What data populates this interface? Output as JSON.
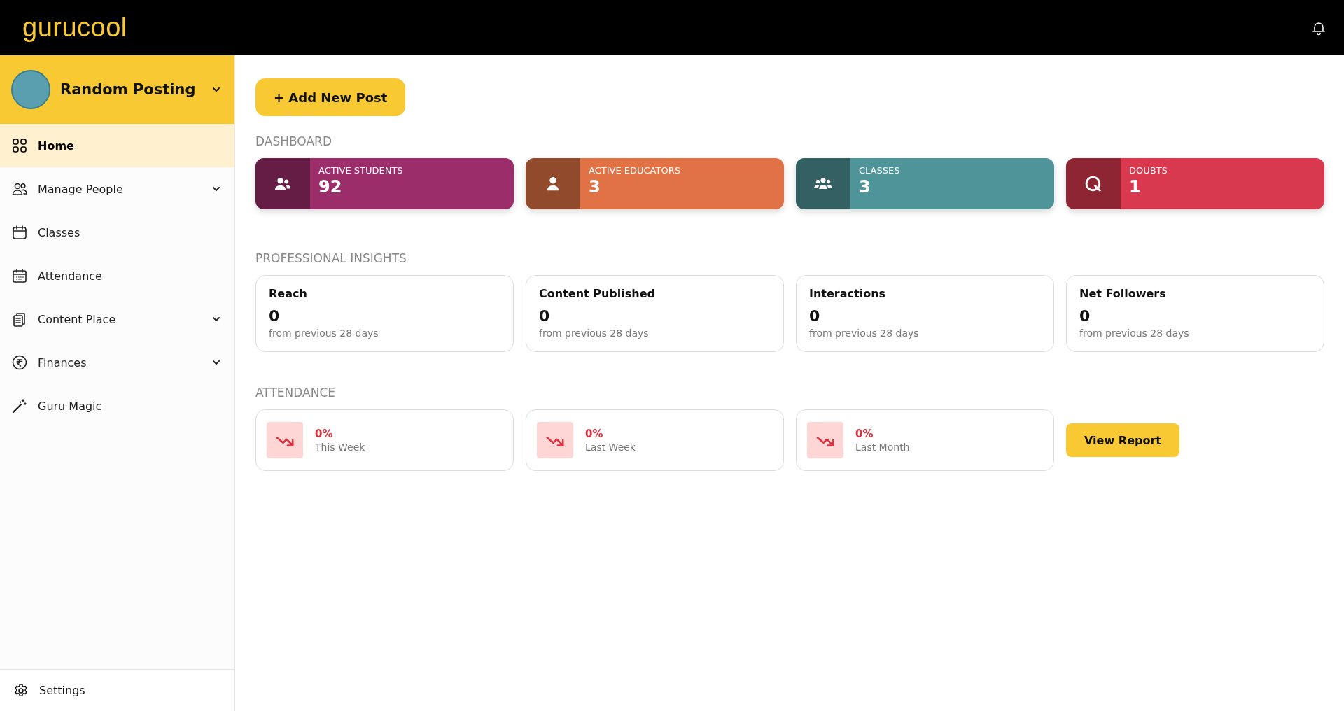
{
  "header": {
    "logo": "gurucool"
  },
  "sidebar": {
    "workspace": {
      "name": "Random Posting"
    },
    "items": [
      {
        "label": "Home",
        "kind": "link",
        "selected": true
      },
      {
        "label": "Manage People",
        "kind": "group",
        "selected": false
      },
      {
        "label": "Classes",
        "kind": "link",
        "selected": false
      },
      {
        "label": "Attendance",
        "kind": "link",
        "selected": false
      },
      {
        "label": "Content Place",
        "kind": "group",
        "selected": false
      },
      {
        "label": "Finances",
        "kind": "group",
        "selected": false
      },
      {
        "label": "Guru Magic",
        "kind": "link",
        "selected": false
      }
    ],
    "footer": {
      "label": "Settings"
    }
  },
  "main": {
    "add_button": "+ Add New Post",
    "dashboard": {
      "title": "DASHBOARD",
      "cards": [
        {
          "label": "ACTIVE STUDENTS",
          "value": "92",
          "color": "#9b2d6b"
        },
        {
          "label": "ACTIVE EDUCATORS",
          "value": "3",
          "color": "#e07245"
        },
        {
          "label": "CLASSES",
          "value": "3",
          "color": "#4e9499"
        },
        {
          "label": "DOUBTS",
          "value": "1",
          "color": "#d9394f"
        }
      ]
    },
    "insights": {
      "title": "PROFESSIONAL INSIGHTS",
      "cards": [
        {
          "label": "Reach",
          "value": "0",
          "note": "from previous 28 days"
        },
        {
          "label": "Content Published",
          "value": "0",
          "note": "from previous 28 days"
        },
        {
          "label": "Interactions",
          "value": "0",
          "note": "from previous 28 days"
        },
        {
          "label": "Net Followers",
          "value": "0",
          "note": "from previous 28 days"
        }
      ]
    },
    "attendance": {
      "title": "ATTENDANCE",
      "cards": [
        {
          "value": "0%",
          "label": "This Week"
        },
        {
          "value": "0%",
          "label": "Last Week"
        },
        {
          "value": "0%",
          "label": "Last Month"
        }
      ],
      "button": "View Report"
    }
  }
}
